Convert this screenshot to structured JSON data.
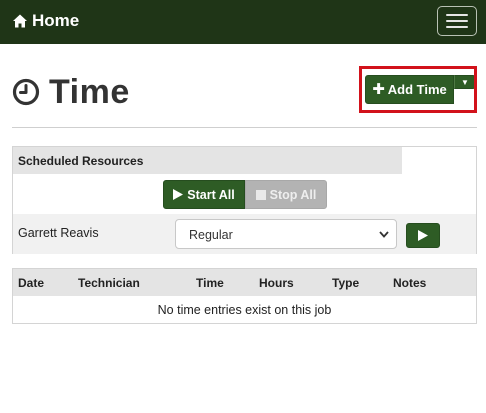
{
  "navbar": {
    "brand_label": "Home",
    "brand_icon": "home-icon",
    "menu_icon": "hamburger-menu-icon",
    "background_color": "#1f3517"
  },
  "page": {
    "title": "Time",
    "title_icon": "clock-icon"
  },
  "add_time": {
    "label": "Add Time",
    "icon": "plus-icon",
    "dropdown_icon": "caret-down-icon",
    "color": "#2e5c25",
    "highlighted": true,
    "highlight_color": "#d2121b"
  },
  "scheduled_resources": {
    "heading": "Scheduled Resources",
    "start_all_label": "Start All",
    "stop_all_label": "Stop All",
    "stop_all_enabled": false,
    "resources": [
      {
        "name": "Garrett Reavis",
        "selected_type": "Regular"
      }
    ]
  },
  "time_entries": {
    "columns": [
      "Date",
      "Technician",
      "Time",
      "Hours",
      "Type",
      "Notes"
    ],
    "empty_message": "No time entries exist on this job"
  }
}
